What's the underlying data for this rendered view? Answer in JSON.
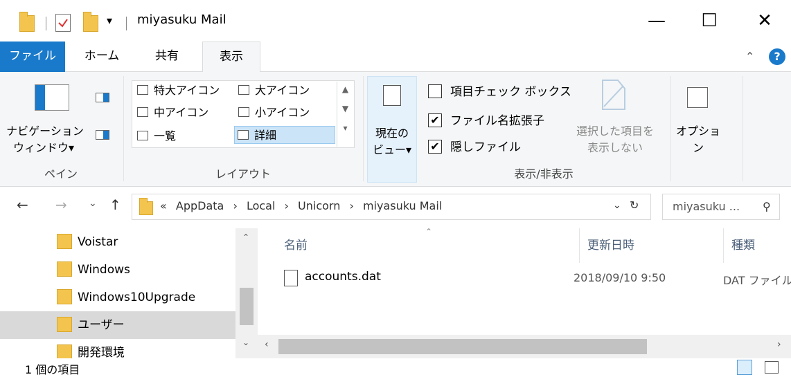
{
  "window": {
    "title": "miyasuku Mail",
    "minimize_glyph": "—",
    "maximize_glyph": "☐",
    "close_glyph": "✕"
  },
  "tabs": [
    {
      "label": "ファイル"
    },
    {
      "label": "ホーム"
    },
    {
      "label": "共有"
    },
    {
      "label": "表示"
    }
  ],
  "ribbon": {
    "pane": {
      "nav_pane_label_line1": "ナビゲーション",
      "nav_pane_label_line2": "ウィンドウ▾",
      "group_label": "ペイン"
    },
    "layout": {
      "items": [
        "特大アイコン",
        "大アイコン",
        "中アイコン",
        "小アイコン",
        "一覧",
        "詳細"
      ],
      "group_label": "レイアウト"
    },
    "current_view": {
      "line1": "現在の",
      "line2": "ビュー▾"
    },
    "show_hide": {
      "checkboxes": [
        {
          "label": "項目チェック ボックス",
          "checked": false
        },
        {
          "label": "ファイル名拡張子",
          "checked": true
        },
        {
          "label": "隠しファイル",
          "checked": true
        }
      ],
      "hide_selected_line1": "選択した項目を",
      "hide_selected_line2": "表示しない",
      "group_label": "表示/非表示"
    },
    "options": {
      "label": "オプション"
    }
  },
  "address": {
    "prefix": "«",
    "crumbs": [
      "AppData",
      "Local",
      "Unicorn",
      "miyasuku Mail"
    ],
    "separator": "›",
    "search_placeholder": "miyasuku ..."
  },
  "nav_pane": {
    "items": [
      {
        "label": "Voistar"
      },
      {
        "label": "Windows"
      },
      {
        "label": "Windows10Upgrade"
      },
      {
        "label": "ユーザー",
        "selected": true
      },
      {
        "label": "開発環境"
      }
    ]
  },
  "content": {
    "columns": [
      "名前",
      "更新日時",
      "種類"
    ],
    "files": [
      {
        "name": "accounts.dat",
        "modified": "2018/09/10 9:50",
        "type": "DAT ファイル"
      }
    ]
  },
  "status": {
    "item_count": "1 個の項目"
  }
}
